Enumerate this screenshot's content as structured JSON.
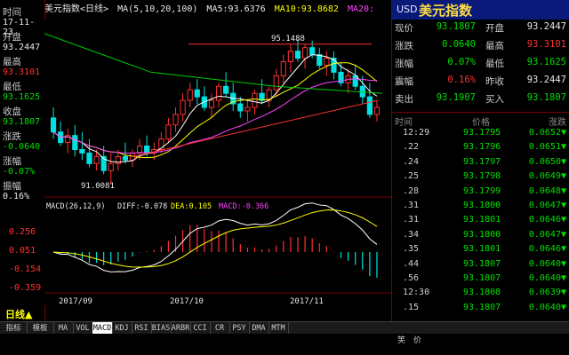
{
  "left_panel": {
    "time_label": "时间",
    "date": "17-11-23",
    "open_label": "开盘",
    "open": "93.2447",
    "high_label": "最高",
    "high": "93.3101",
    "low_label": "最低",
    "low": "93.1625",
    "close_label": "收盘",
    "close": "93.1807",
    "change_label": "涨跌",
    "change": "-0.0640",
    "pct_label": "涨幅",
    "pct": "-0.07%",
    "amp_label": "振幅",
    "amp": "0.16%"
  },
  "title_bar": {
    "name": "美元指数<日线>",
    "ma_label": "MA(5,10,20,100)",
    "ma5": "MA5:93.6376",
    "ma10": "MA10:93.8682",
    "ma20": "MA20:"
  },
  "quote": {
    "currency": "USD",
    "name": "美元指数",
    "rows": [
      {
        "l1": "现价",
        "v1": "93.1807",
        "c1": "#00e000",
        "l2": "开盘",
        "v2": "93.2447",
        "c2": "#e8e8e8"
      },
      {
        "l1": "涨跌",
        "v1": "0.0640",
        "c1": "#00e000",
        "l2": "最高",
        "v2": "93.3101",
        "c2": "#ff3030"
      },
      {
        "l1": "涨幅",
        "v1": "0.07%",
        "c1": "#00e000",
        "l2": "最低",
        "v2": "93.1625",
        "c2": "#00e000"
      },
      {
        "l1": "震幅",
        "v1": "0.16%",
        "c1": "#ff3030",
        "l2": "昨收",
        "v2": "93.2447",
        "c2": "#e8e8e8"
      },
      {
        "l1": "卖出",
        "v1": "93.1907",
        "c1": "#00e000",
        "l2": "买入",
        "v2": "93.1807",
        "c2": "#00e000"
      }
    ],
    "tick_header": {
      "time": "时间",
      "price": "价格",
      "change": "涨跌"
    },
    "ticks": [
      {
        "t": "12:29",
        "p": "93.1795",
        "c": "0.0652▼"
      },
      {
        "t": ".22",
        "p": "93.1796",
        "c": "0.0651▼"
      },
      {
        "t": ".24",
        "p": "93.1797",
        "c": "0.0650▼"
      },
      {
        "t": ".25",
        "p": "93.1798",
        "c": "0.0649▼"
      },
      {
        "t": ".28",
        "p": "93.1799",
        "c": "0.0648▼"
      },
      {
        "t": ".31",
        "p": "93.1800",
        "c": "0.0647▼"
      },
      {
        "t": ".31",
        "p": "93.1801",
        "c": "0.0646▼"
      },
      {
        "t": ".34",
        "p": "93.1800",
        "c": "0.0647▼"
      },
      {
        "t": ".35",
        "p": "93.1801",
        "c": "0.0646▼"
      },
      {
        "t": ".44",
        "p": "93.1807",
        "c": "0.0640▼"
      },
      {
        "t": ".56",
        "p": "93.1807",
        "c": "0.0640▼"
      },
      {
        "t": "12:30",
        "p": "93.1808",
        "c": "0.0639▼"
      },
      {
        "t": ".15",
        "p": "93.1807",
        "c": "0.0640▼"
      }
    ]
  },
  "period_label": "日线▲",
  "tabs": [
    "指标",
    "模板",
    "MA",
    "VOL",
    "MACD",
    "KDJ",
    "RSI",
    "BIAS",
    "ARBR",
    "CCI",
    "CR",
    "PSY",
    "DMA",
    "MTM"
  ],
  "status": {
    "left": "笑",
    "right": "价"
  },
  "chart_data": {
    "type": "candlestick",
    "x_tick_labels": [
      "2017/09",
      "2017/10",
      "2017/11"
    ],
    "annotations": {
      "high": "95.1488",
      "low": "91.0081"
    },
    "macd_label": "MACD(26,12,9)",
    "diff": "DIFF:-0.078",
    "dea": "DEA:0.105",
    "macd": "MACD:-0.366",
    "macd_yticks": [
      "0.256",
      "0.051",
      "-0.154",
      "-0.359"
    ],
    "ohlc": [
      [
        92.9,
        93.2,
        92.3,
        92.5
      ],
      [
        92.5,
        92.8,
        92.1,
        92.2
      ],
      [
        92.2,
        92.6,
        91.9,
        92.4
      ],
      [
        92.4,
        92.7,
        91.8,
        92.0
      ],
      [
        92.0,
        92.5,
        91.7,
        91.9
      ],
      [
        91.9,
        92.3,
        91.5,
        91.6
      ],
      [
        91.6,
        92.0,
        91.4,
        91.8
      ],
      [
        91.8,
        92.1,
        91.3,
        91.4
      ],
      [
        91.4,
        91.9,
        91.0,
        91.6
      ],
      [
        91.6,
        92.0,
        91.4,
        91.8
      ],
      [
        91.8,
        92.2,
        91.6,
        91.7
      ],
      [
        91.7,
        92.0,
        91.5,
        91.9
      ],
      [
        91.9,
        92.3,
        91.7,
        92.1
      ],
      [
        92.1,
        92.4,
        91.8,
        91.9
      ],
      [
        91.9,
        92.2,
        91.7,
        92.0
      ],
      [
        92.0,
        92.5,
        91.9,
        92.3
      ],
      [
        92.3,
        92.9,
        92.2,
        92.7
      ],
      [
        92.7,
        93.2,
        92.5,
        93.0
      ],
      [
        93.0,
        93.6,
        92.8,
        93.4
      ],
      [
        93.4,
        93.9,
        93.2,
        93.7
      ],
      [
        93.7,
        94.0,
        93.3,
        93.5
      ],
      [
        93.5,
        93.8,
        93.1,
        93.2
      ],
      [
        93.2,
        93.6,
        92.9,
        93.4
      ],
      [
        93.4,
        93.9,
        93.2,
        93.8
      ],
      [
        93.8,
        94.2,
        93.5,
        93.6
      ],
      [
        93.6,
        93.9,
        93.1,
        93.3
      ],
      [
        93.3,
        93.5,
        92.9,
        93.1
      ],
      [
        93.1,
        93.4,
        92.8,
        93.2
      ],
      [
        93.2,
        93.7,
        93.0,
        93.6
      ],
      [
        93.6,
        94.0,
        93.3,
        93.4
      ],
      [
        93.4,
        93.8,
        93.2,
        93.7
      ],
      [
        93.7,
        94.3,
        93.5,
        94.1
      ],
      [
        94.1,
        94.7,
        93.9,
        94.5
      ],
      [
        94.5,
        95.0,
        94.2,
        94.8
      ],
      [
        94.8,
        95.15,
        94.5,
        94.6
      ],
      [
        94.6,
        95.0,
        94.3,
        94.9
      ],
      [
        94.9,
        95.1,
        94.6,
        94.7
      ],
      [
        94.7,
        94.9,
        94.3,
        94.4
      ],
      [
        94.4,
        94.8,
        94.1,
        94.6
      ],
      [
        94.6,
        94.8,
        94.0,
        94.2
      ],
      [
        94.2,
        94.5,
        93.8,
        93.9
      ],
      [
        93.9,
        94.3,
        93.6,
        94.1
      ],
      [
        94.1,
        94.4,
        93.7,
        93.8
      ],
      [
        93.8,
        94.1,
        93.3,
        93.5
      ],
      [
        93.5,
        93.9,
        92.9,
        93.0
      ],
      [
        93.0,
        93.4,
        92.8,
        93.2
      ]
    ],
    "up_color": "#ff3030",
    "down_color": "#00e0e0"
  }
}
